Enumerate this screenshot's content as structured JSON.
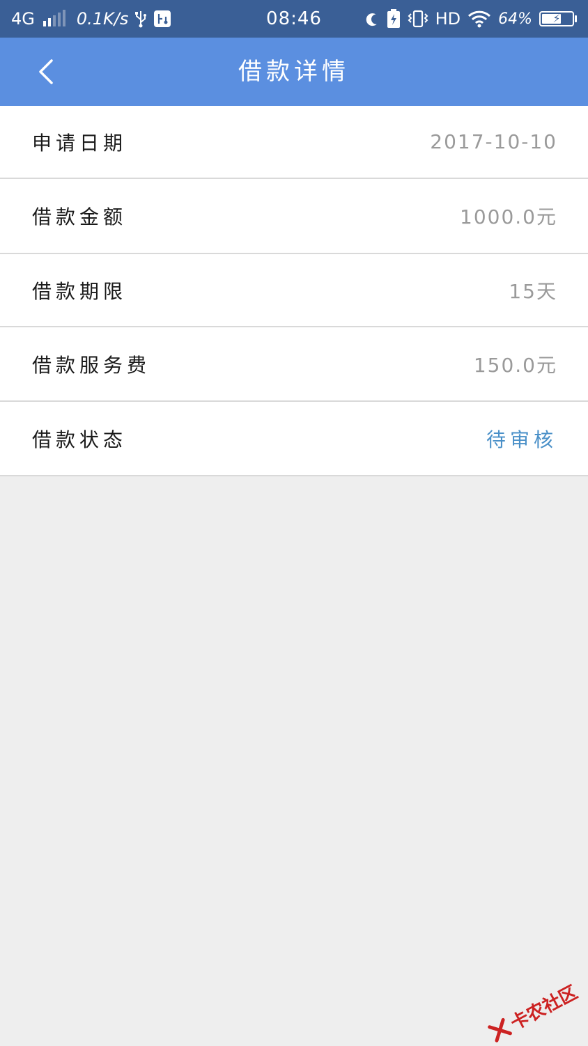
{
  "status_bar": {
    "network": "4G",
    "speed": "0.1K/s",
    "time": "08:46",
    "hd": "HD",
    "battery": "64%"
  },
  "nav": {
    "title": "借款详情"
  },
  "rows": [
    {
      "label": "申请日期",
      "value": "2017-10-10"
    },
    {
      "label": "借款金额",
      "value": "1000.0元"
    },
    {
      "label": "借款期限",
      "value": "15天"
    },
    {
      "label": "借款服务费",
      "value": "150.0元"
    },
    {
      "label": "借款状态",
      "value": "待审核"
    }
  ],
  "watermark": {
    "text": "卡农社区"
  },
  "colors": {
    "status_bar_bg": "#3a5f96",
    "nav_bg": "#5b8fe0",
    "status_value": "#4a90c8",
    "page_bg": "#eeeeee"
  },
  "battery_level": 0.64
}
